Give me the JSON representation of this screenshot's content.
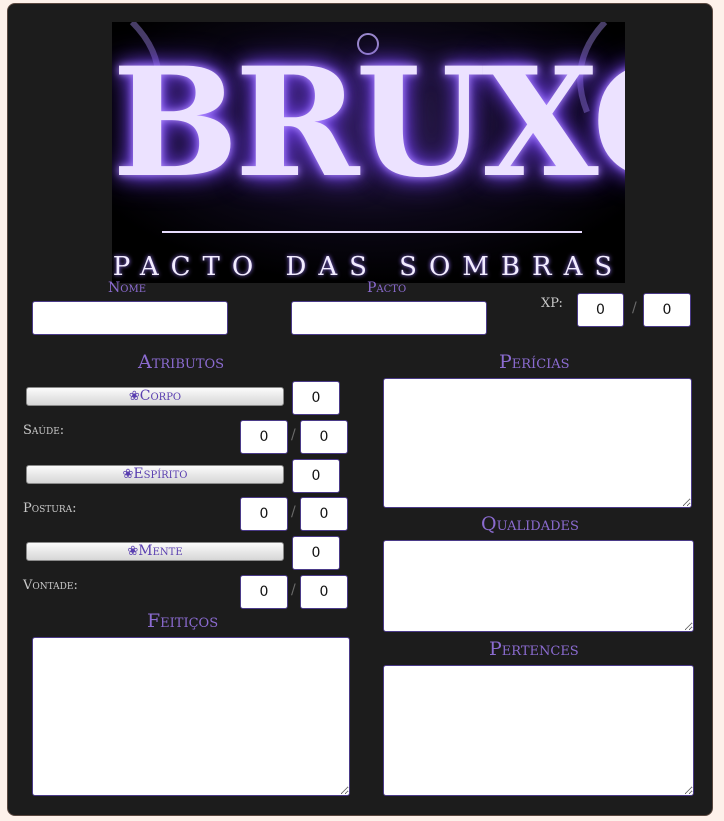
{
  "banner": {
    "title": "BRUXO",
    "subtitle": "PACTO DAS SOMBRAS"
  },
  "top": {
    "nome_label": "Nome",
    "nome_value": "",
    "pacto_label": "Pacto",
    "pacto_value": "",
    "xp_label": "XP:",
    "xp_current": "0",
    "xp_max": "0",
    "separator": "/"
  },
  "atributos": {
    "heading": "Atributos",
    "die_icon": "d20-icon",
    "items": [
      {
        "label": "Corpo",
        "value": "0",
        "sub_label": "Saúde:",
        "sub_current": "0",
        "sub_max": "0"
      },
      {
        "label": "Espírito",
        "value": "0",
        "sub_label": "Postura:",
        "sub_current": "0",
        "sub_max": "0"
      },
      {
        "label": "Mente",
        "value": "0",
        "sub_label": "Vontade:",
        "sub_current": "0",
        "sub_max": "0"
      }
    ]
  },
  "feiticos": {
    "heading": "Feitiços",
    "value": ""
  },
  "pericias": {
    "heading": "Perícias",
    "value": ""
  },
  "qualidades": {
    "heading": "Qualidades",
    "value": ""
  },
  "pertences": {
    "heading": "Pertences",
    "value": ""
  },
  "colors": {
    "sheet_bg": "#1c1c1c",
    "accent": "#8b6bd0",
    "page_bg": "#fdf1ea",
    "glow": "#7d4dff"
  }
}
